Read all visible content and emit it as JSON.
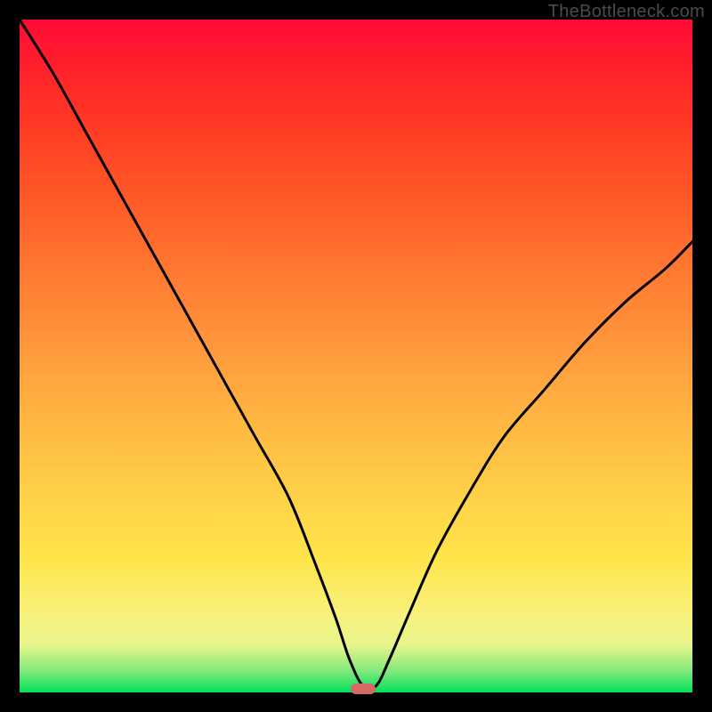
{
  "watermark": "TheBottleneck.com",
  "chart_data": {
    "type": "line",
    "title": "",
    "xlabel": "",
    "ylabel": "",
    "xlim": [
      0,
      100
    ],
    "ylim": [
      0,
      100
    ],
    "grid": false,
    "legend": false,
    "series": [
      {
        "name": "bottleneck-curve",
        "x": [
          0,
          5,
          10,
          15,
          20,
          25,
          30,
          35,
          40,
          44,
          47,
          49,
          51,
          53,
          55,
          58,
          62,
          67,
          72,
          78,
          84,
          90,
          96,
          100
        ],
        "y": [
          100,
          92,
          83,
          74,
          65,
          56,
          47,
          38,
          29,
          19,
          11,
          5,
          1,
          1,
          5,
          12,
          21,
          30,
          38,
          45,
          52,
          58,
          63,
          67
        ]
      }
    ],
    "annotations": [
      {
        "name": "valley-marker",
        "x": 51,
        "y": 0.5,
        "color": "#d46a63"
      }
    ],
    "background_gradient": {
      "direction": "vertical",
      "stops": [
        {
          "pos": 0.0,
          "color": "#00e05a"
        },
        {
          "pos": 0.07,
          "color": "#e8f58e"
        },
        {
          "pos": 0.2,
          "color": "#ffe44a"
        },
        {
          "pos": 0.5,
          "color": "#ffad40"
        },
        {
          "pos": 0.8,
          "color": "#ff5226"
        },
        {
          "pos": 1.0,
          "color": "#ff0a36"
        }
      ]
    }
  }
}
